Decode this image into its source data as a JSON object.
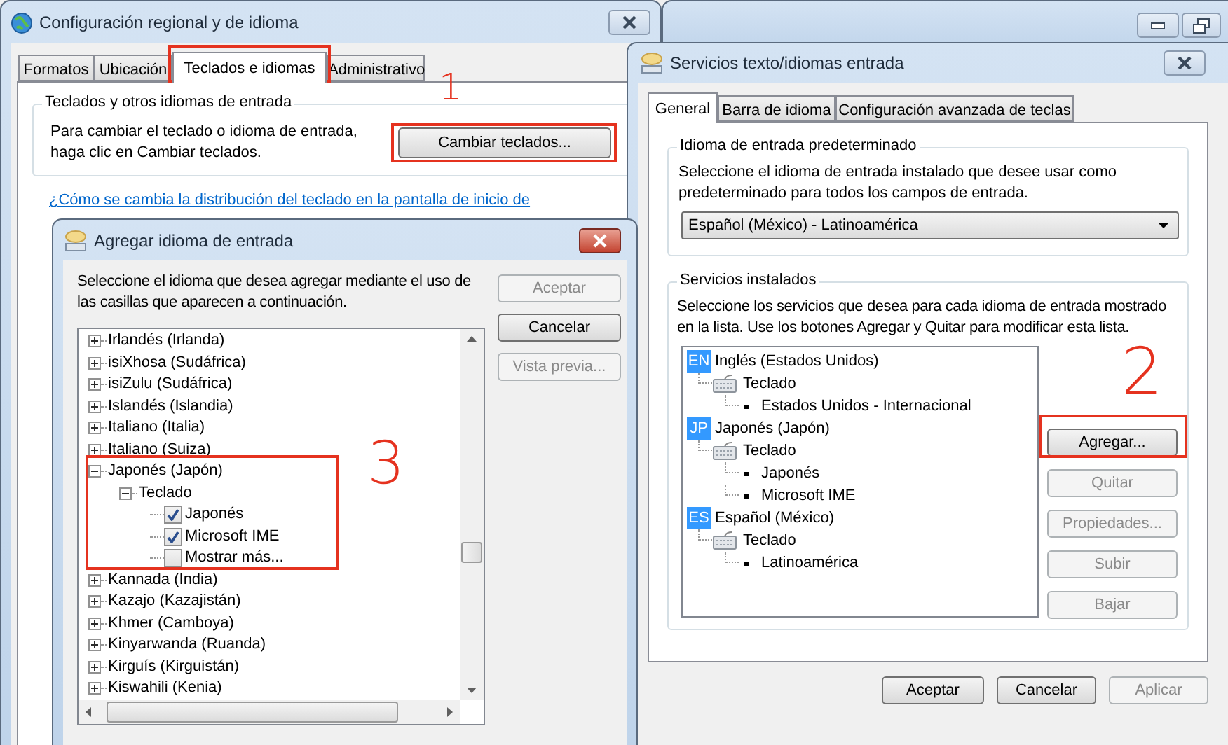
{
  "regional_window": {
    "title": "Configuración regional y de idioma",
    "tabs": [
      {
        "label": "Formatos",
        "selected": false
      },
      {
        "label": "Ubicación",
        "selected": false
      },
      {
        "label": "Teclados e idiomas",
        "selected": true
      },
      {
        "label": "Administrativo",
        "selected": false
      }
    ],
    "group": {
      "title": "Teclados y otros idiomas de entrada",
      "text": "Para cambiar el teclado o idioma de entrada, haga clic en Cambiar teclados.",
      "button": "Cambiar teclados..."
    },
    "link": "¿Cómo se cambia la distribución del teclado en la pantalla de inicio de"
  },
  "services_window": {
    "title": "Servicios texto/idiomas entrada",
    "tabs": [
      {
        "label": "General",
        "selected": true
      },
      {
        "label": "Barra de idioma",
        "selected": false
      },
      {
        "label": "Configuración avanzada de teclas",
        "selected": false
      }
    ],
    "default_group": {
      "title": "Idioma de entrada predeterminado",
      "text": "Seleccione el idioma de entrada instalado que desee usar como predeterminado para todos los campos de entrada.",
      "dropdown": {
        "value": "Español (México) - Latinoamérica"
      }
    },
    "installed_group": {
      "title": "Servicios instalados",
      "text": "Seleccione los servicios que desea para cada idioma de entrada mostrado en la lista. Use los botones Agregar y Quitar para modificar esta lista.",
      "languages": [
        {
          "code": "EN",
          "name": "Inglés (Estados Unidos)",
          "children": [
            {
              "label": "Teclado",
              "children": [
                {
                  "label": "Estados Unidos - Internacional"
                }
              ]
            }
          ]
        },
        {
          "code": "JP",
          "name": "Japonés (Japón)",
          "children": [
            {
              "label": "Teclado",
              "children": [
                {
                  "label": "Japonés"
                },
                {
                  "label": "Microsoft IME"
                }
              ]
            }
          ]
        },
        {
          "code": "ES",
          "name": "Español (México)",
          "children": [
            {
              "label": "Teclado",
              "children": [
                {
                  "label": "Latinoamérica"
                }
              ]
            }
          ]
        }
      ],
      "buttons": [
        {
          "label": "Agregar...",
          "disabled": false
        },
        {
          "label": "Quitar",
          "disabled": true
        },
        {
          "label": "Propiedades...",
          "disabled": true
        },
        {
          "label": "Subir",
          "disabled": true
        },
        {
          "label": "Bajar",
          "disabled": true
        }
      ]
    },
    "buttons": [
      {
        "label": "Aceptar",
        "disabled": false
      },
      {
        "label": "Cancelar",
        "disabled": false
      },
      {
        "label": "Aplicar",
        "disabled": true
      }
    ]
  },
  "add_window": {
    "title": "Agregar idioma de entrada",
    "text": "Seleccione el idioma que desea agregar mediante el uso de las casillas que aparecen a continuación.",
    "tree": [
      {
        "kind": "node",
        "label": "Irlandés (Irlanda)",
        "expanded": false
      },
      {
        "kind": "node",
        "label": "isiXhosa (Sudáfrica)",
        "expanded": false
      },
      {
        "kind": "node",
        "label": "isiZulu (Sudáfrica)",
        "expanded": false
      },
      {
        "kind": "node",
        "label": "Islandés (Islandia)",
        "expanded": false
      },
      {
        "kind": "node",
        "label": "Italiano (Italia)",
        "expanded": false
      },
      {
        "kind": "node",
        "label": "Italiano (Suiza)",
        "expanded": false
      },
      {
        "kind": "node",
        "label": "Japonés (Japón)",
        "expanded": true,
        "children": [
          {
            "kind": "node",
            "label": "Teclado",
            "expanded": true,
            "children": [
              {
                "kind": "option",
                "label": "Japonés",
                "checked": true
              },
              {
                "kind": "option",
                "label": "Microsoft IME",
                "checked": true
              },
              {
                "kind": "option",
                "label": "Mostrar más...",
                "checked": false
              }
            ]
          }
        ]
      },
      {
        "kind": "node",
        "label": "Kannada (India)",
        "expanded": false
      },
      {
        "kind": "node",
        "label": "Kazajo (Kazajistán)",
        "expanded": false
      },
      {
        "kind": "node",
        "label": "Khmer (Camboya)",
        "expanded": false
      },
      {
        "kind": "node",
        "label": "Kinyarwanda (Ruanda)",
        "expanded": false
      },
      {
        "kind": "node",
        "label": "Kirguís (Kirguistán)",
        "expanded": false
      },
      {
        "kind": "node",
        "label": "Kiswahili (Kenia)",
        "expanded": false
      }
    ],
    "buttons": [
      {
        "label": "Aceptar",
        "disabled": true
      },
      {
        "label": "Cancelar",
        "disabled": false
      },
      {
        "label": "Vista previa...",
        "disabled": true
      }
    ]
  },
  "annotations": [
    {
      "label": "1"
    },
    {
      "label": "2"
    },
    {
      "label": "3"
    }
  ]
}
